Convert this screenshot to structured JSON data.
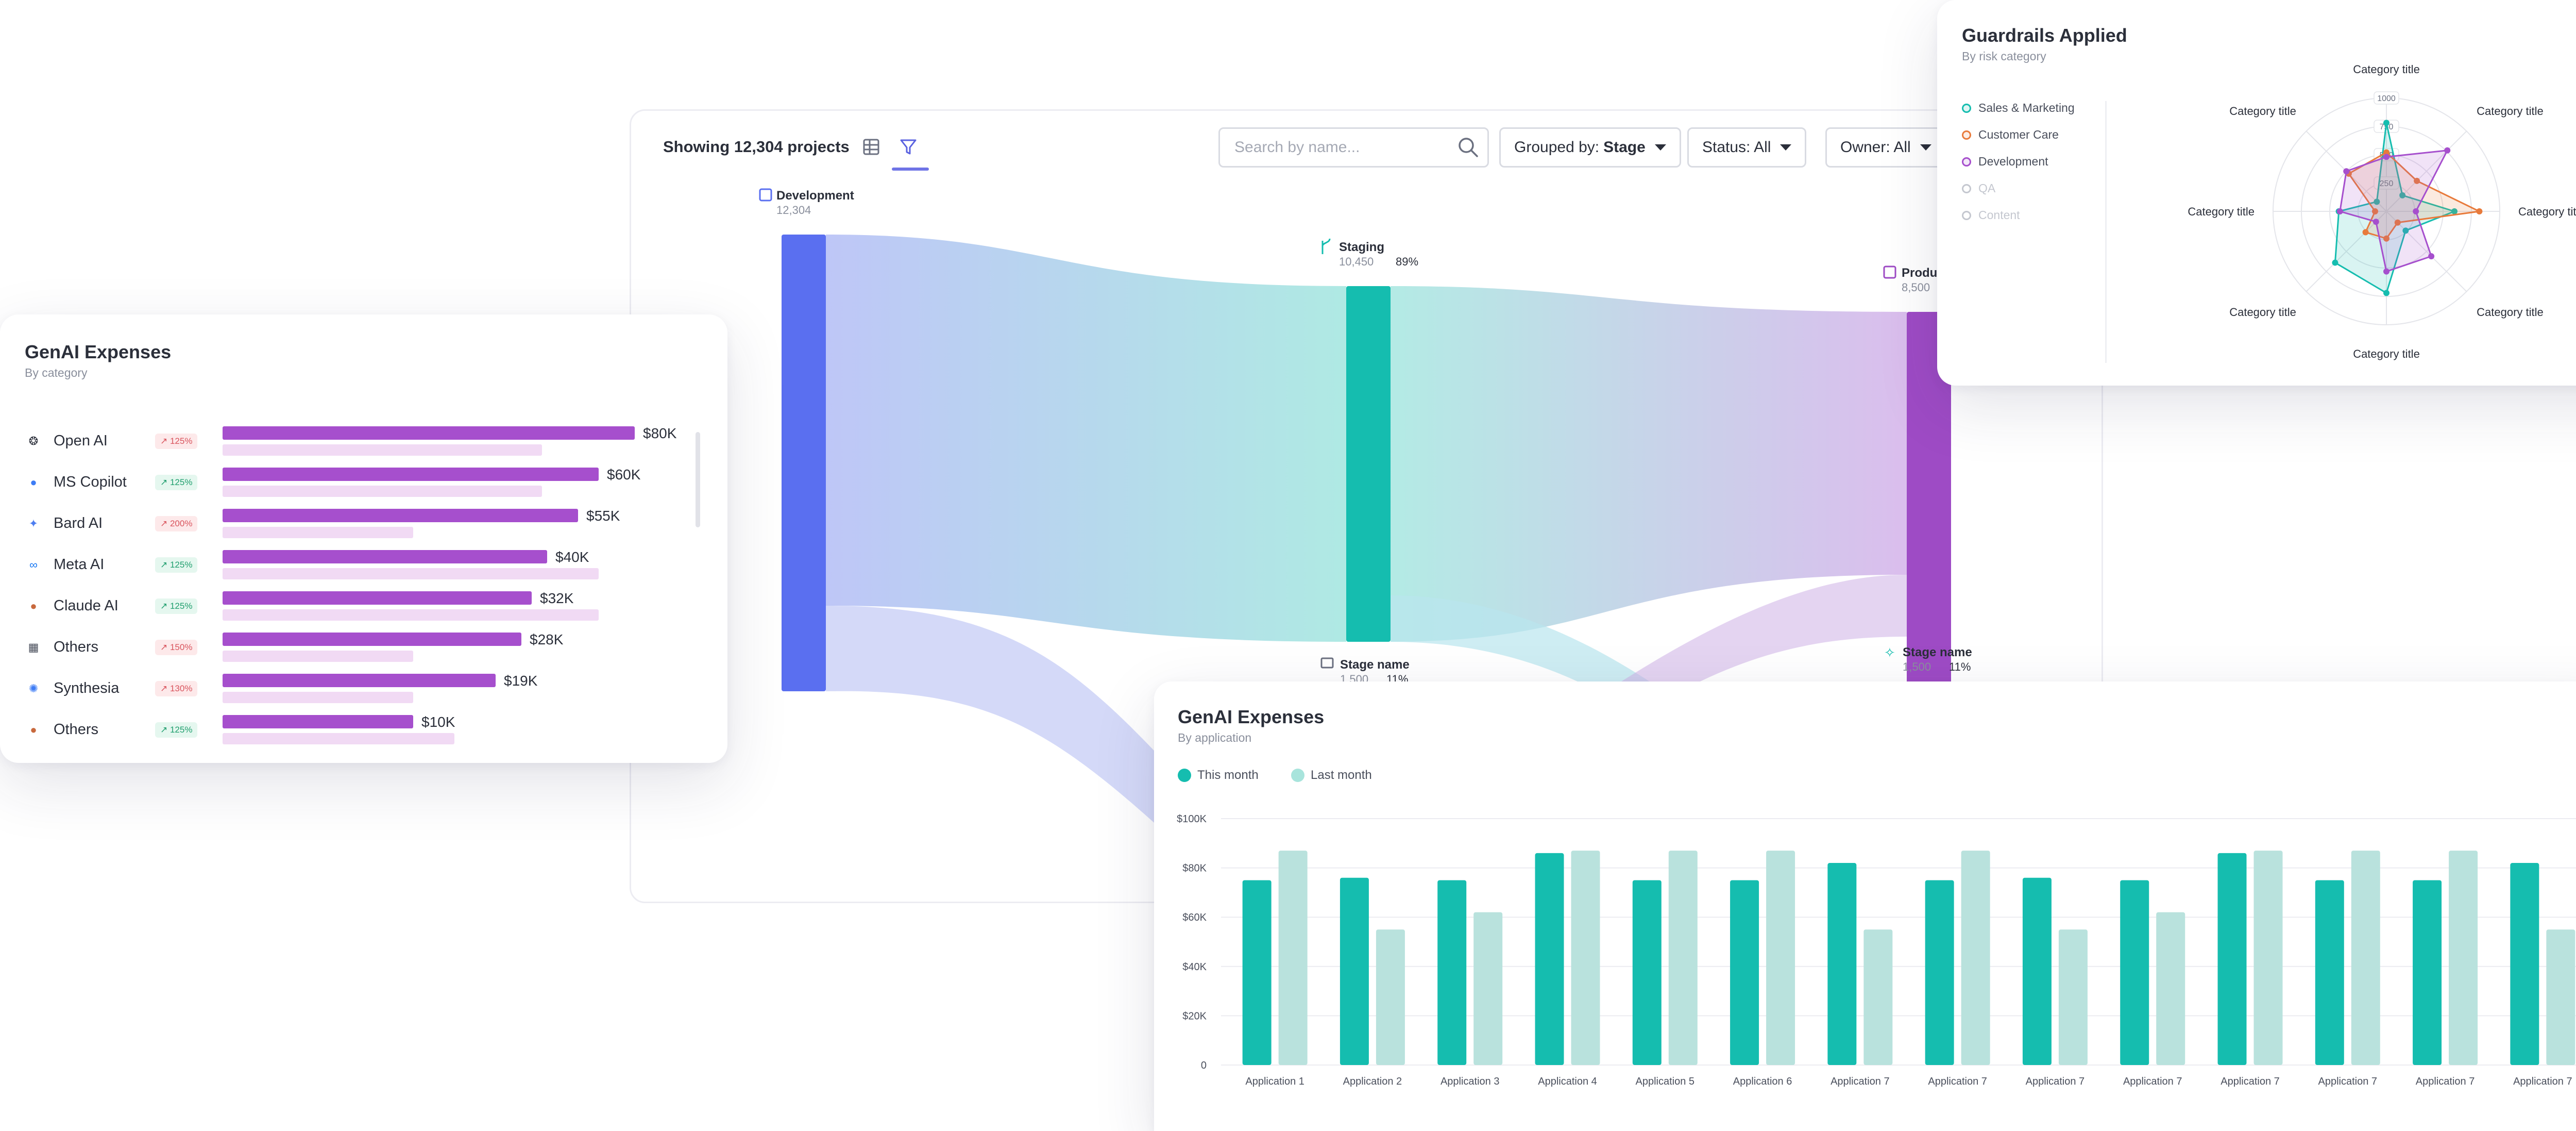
{
  "sankey": {
    "showing": "Showing 12,304 projects",
    "search_placeholder": "Search by name...",
    "grouped_prefix": "Grouped by:",
    "grouped_value": "Stage",
    "status_label": "Status: All",
    "owner_label": "Owner: All",
    "nodes": [
      {
        "name": "Development",
        "value": "12,304",
        "pct": "",
        "icon": "calendar-icon",
        "color": "#5a6ff0"
      },
      {
        "name": "Staging",
        "value": "10,450",
        "pct": "89%",
        "icon": "branch-icon",
        "color": "#15bdaf"
      },
      {
        "name": "Production",
        "value": "8,500",
        "pct": "",
        "icon": "deploy-icon",
        "color": "#9e4bc5"
      },
      {
        "name": "Stage name",
        "value": "1,500",
        "pct": "11%",
        "icon": "inbox-icon",
        "color": "#8a8f9c"
      },
      {
        "name": "Stage name",
        "value": "1,500",
        "pct": "11%",
        "icon": "sparkle-icon",
        "color": "#15bdaf"
      }
    ]
  },
  "category_card": {
    "title": "GenAI Expenses",
    "subtitle": "By category",
    "items": [
      {
        "label": "Open AI",
        "badge": "↗ 125%",
        "trend": "down",
        "value": "$80K",
        "current": 80,
        "previous": 62,
        "icon": "openai-icon",
        "icon_color": "#2b2f3a"
      },
      {
        "label": "MS Copilot",
        "badge": "↗ 125%",
        "trend": "up",
        "value": "$60K",
        "current": 73,
        "previous": 62,
        "icon": "copilot-icon",
        "icon_color": "#3d7cf5"
      },
      {
        "label": "Bard AI",
        "badge": "↗ 200%",
        "trend": "down",
        "value": "$55K",
        "current": 69,
        "previous": 37,
        "icon": "bard-icon",
        "icon_color": "#4c7df0"
      },
      {
        "label": "Meta AI",
        "badge": "↗ 125%",
        "trend": "up",
        "value": "$40K",
        "current": 63,
        "previous": 73,
        "icon": "meta-icon",
        "icon_color": "#1877f2"
      },
      {
        "label": "Claude AI",
        "badge": "↗ 125%",
        "trend": "up",
        "value": "$32K",
        "current": 60,
        "previous": 73,
        "icon": "claude-icon",
        "icon_color": "#c8693d"
      },
      {
        "label": "Others",
        "badge": "↗ 150%",
        "trend": "down",
        "value": "$28K",
        "current": 58,
        "previous": 37,
        "icon": "grid-icon",
        "icon_color": "#4a4f5c"
      },
      {
        "label": "Synthesia",
        "badge": "↗ 130%",
        "trend": "down",
        "value": "$19K",
        "current": 53,
        "previous": 37,
        "icon": "synthesia-icon",
        "icon_color": "#3d7cf5"
      },
      {
        "label": "Others",
        "badge": "↗ 125%",
        "trend": "up",
        "value": "$10K",
        "current": 37,
        "previous": 45,
        "icon": "others-icon",
        "icon_color": "#c8693d"
      }
    ]
  },
  "guardrails": {
    "title": "Guardrails Applied",
    "subtitle": "By risk category",
    "legend": [
      {
        "label": "Sales & Marketing",
        "color": "#15bdaf",
        "enabled": true
      },
      {
        "label": "Customer Care",
        "color": "#e87a3b",
        "enabled": true
      },
      {
        "label": "Development",
        "color": "#a64fcd",
        "enabled": true
      },
      {
        "label": "QA",
        "color": "#c4c7cf",
        "enabled": false
      },
      {
        "label": "Content",
        "color": "#c4c7cf",
        "enabled": false
      }
    ],
    "chart_data": {
      "type": "radar",
      "axes": [
        "Category title",
        "Category title",
        "Category title",
        "Category title",
        "Category title",
        "Category title",
        "Category title",
        "Category title"
      ],
      "ring_labels": [
        "1000",
        "750",
        "500",
        "250"
      ],
      "max": 1000,
      "series": [
        {
          "name": "Sales & Marketing",
          "color": "#15bdaf",
          "values": [
            780,
            200,
            600,
            240,
            720,
            640,
            420,
            120
          ]
        },
        {
          "name": "Customer Care",
          "color": "#e87a3b",
          "values": [
            520,
            380,
            820,
            140,
            240,
            260,
            100,
            470
          ]
        },
        {
          "name": "Development",
          "color": "#a64fcd",
          "values": [
            480,
            760,
            260,
            560,
            530,
            130,
            410,
            500
          ]
        }
      ]
    }
  },
  "app_card": {
    "title": "GenAI Expenses",
    "subtitle": "By application",
    "legend": [
      {
        "label": "This month",
        "color": "#15bdaf"
      },
      {
        "label": "Last month",
        "color": "#a8e4dc"
      }
    ],
    "chart_data": {
      "type": "bar",
      "categories": [
        "Application 1",
        "Application 2",
        "Application 3",
        "Application 4",
        "Application 5",
        "Application 6",
        "Application 7",
        "Application 7",
        "Application 7",
        "Application 7",
        "Application 7",
        "Application 7",
        "Application 7",
        "Application 7"
      ],
      "series": [
        {
          "name": "This month",
          "values": [
            75,
            76,
            75,
            86,
            75,
            75,
            82,
            75,
            76,
            75,
            86,
            75,
            75,
            82
          ]
        },
        {
          "name": "Last month",
          "values": [
            87,
            55,
            62,
            87,
            87,
            87,
            55,
            87,
            55,
            62,
            87,
            87,
            87,
            55
          ]
        }
      ],
      "ylim": [
        0,
        100
      ],
      "yticks": [
        "0",
        "$20K",
        "$40K",
        "$60K",
        "$80K",
        "$100K"
      ]
    }
  }
}
